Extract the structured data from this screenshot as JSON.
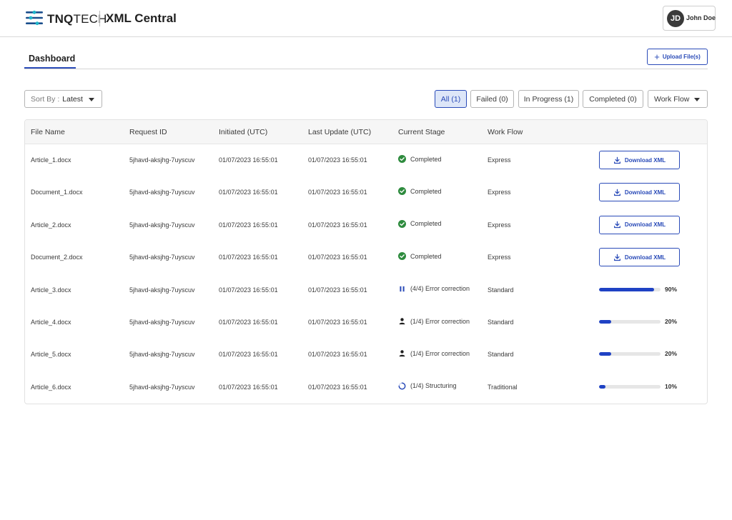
{
  "header": {
    "brand_bold": "TNQ",
    "brand_rest": "TECH",
    "app_title": "XML Central",
    "user": {
      "initials": "JD",
      "name": "John Doe"
    }
  },
  "tabs": {
    "active": "Dashboard"
  },
  "upload_button": "Upload File(s)",
  "sort": {
    "label": "Sort By :",
    "value": "Latest"
  },
  "filters": {
    "all": "All (1)",
    "failed": "Failed (0)",
    "in_progress": "In Progress (1)",
    "completed": "Completed (0)",
    "workflow": "Work Flow"
  },
  "colors": {
    "accent": "#2a4bb8",
    "progress": "#1f42c4",
    "success": "#2e8b3e"
  },
  "table": {
    "columns": [
      "File Name",
      "Request ID",
      "Initiated (UTC)",
      "Last Update (UTC)",
      "Current Stage",
      "Work Flow"
    ],
    "download_label": "Download XML",
    "rows": [
      {
        "file": "Article_1.docx",
        "request_id": "5jhavd-aksjhg-7uyscuv",
        "initiated": "01/07/2023 16:55:01",
        "updated": "01/07/2023 16:55:01",
        "stage": "Completed",
        "stage_icon": "check-circle-icon",
        "workflow": "Express",
        "action": "download"
      },
      {
        "file": "Document_1.docx",
        "request_id": "5jhavd-aksjhg-7uyscuv",
        "initiated": "01/07/2023 16:55:01",
        "updated": "01/07/2023 16:55:01",
        "stage": "Completed",
        "stage_icon": "check-circle-icon",
        "workflow": "Express",
        "action": "download"
      },
      {
        "file": "Article_2.docx",
        "request_id": "5jhavd-aksjhg-7uyscuv",
        "initiated": "01/07/2023 16:55:01",
        "updated": "01/07/2023 16:55:01",
        "stage": "Completed",
        "stage_icon": "check-circle-icon",
        "workflow": "Express",
        "action": "download"
      },
      {
        "file": "Document_2.docx",
        "request_id": "5jhavd-aksjhg-7uyscuv",
        "initiated": "01/07/2023 16:55:01",
        "updated": "01/07/2023 16:55:01",
        "stage": "Completed",
        "stage_icon": "check-circle-icon",
        "workflow": "Express",
        "action": "download"
      },
      {
        "file": "Article_3.docx",
        "request_id": "5jhavd-aksjhg-7uyscuv",
        "initiated": "01/07/2023 16:55:01",
        "updated": "01/07/2023 16:55:01",
        "stage": "(4/4) Error correction",
        "stage_icon": "pause-icon",
        "workflow": "Standard",
        "action": "progress",
        "progress": 90,
        "progress_label": "90%"
      },
      {
        "file": "Article_4.docx",
        "request_id": "5jhavd-aksjhg-7uyscuv",
        "initiated": "01/07/2023 16:55:01",
        "updated": "01/07/2023 16:55:01",
        "stage": "(1/4) Error correction",
        "stage_icon": "person-icon",
        "workflow": "Standard",
        "action": "progress",
        "progress": 20,
        "progress_label": "20%"
      },
      {
        "file": "Article_5.docx",
        "request_id": "5jhavd-aksjhg-7uyscuv",
        "initiated": "01/07/2023 16:55:01",
        "updated": "01/07/2023 16:55:01",
        "stage": "(1/4) Error correction",
        "stage_icon": "person-icon",
        "workflow": "Standard",
        "action": "progress",
        "progress": 20,
        "progress_label": "20%"
      },
      {
        "file": "Article_6.docx",
        "request_id": "5jhavd-aksjhg-7uyscuv",
        "initiated": "01/07/2023 16:55:01",
        "updated": "01/07/2023 16:55:01",
        "stage": "(1/4) Structuring",
        "stage_icon": "spinner-icon",
        "workflow": "Traditional",
        "action": "progress",
        "progress": 10,
        "progress_label": "10%"
      }
    ]
  }
}
